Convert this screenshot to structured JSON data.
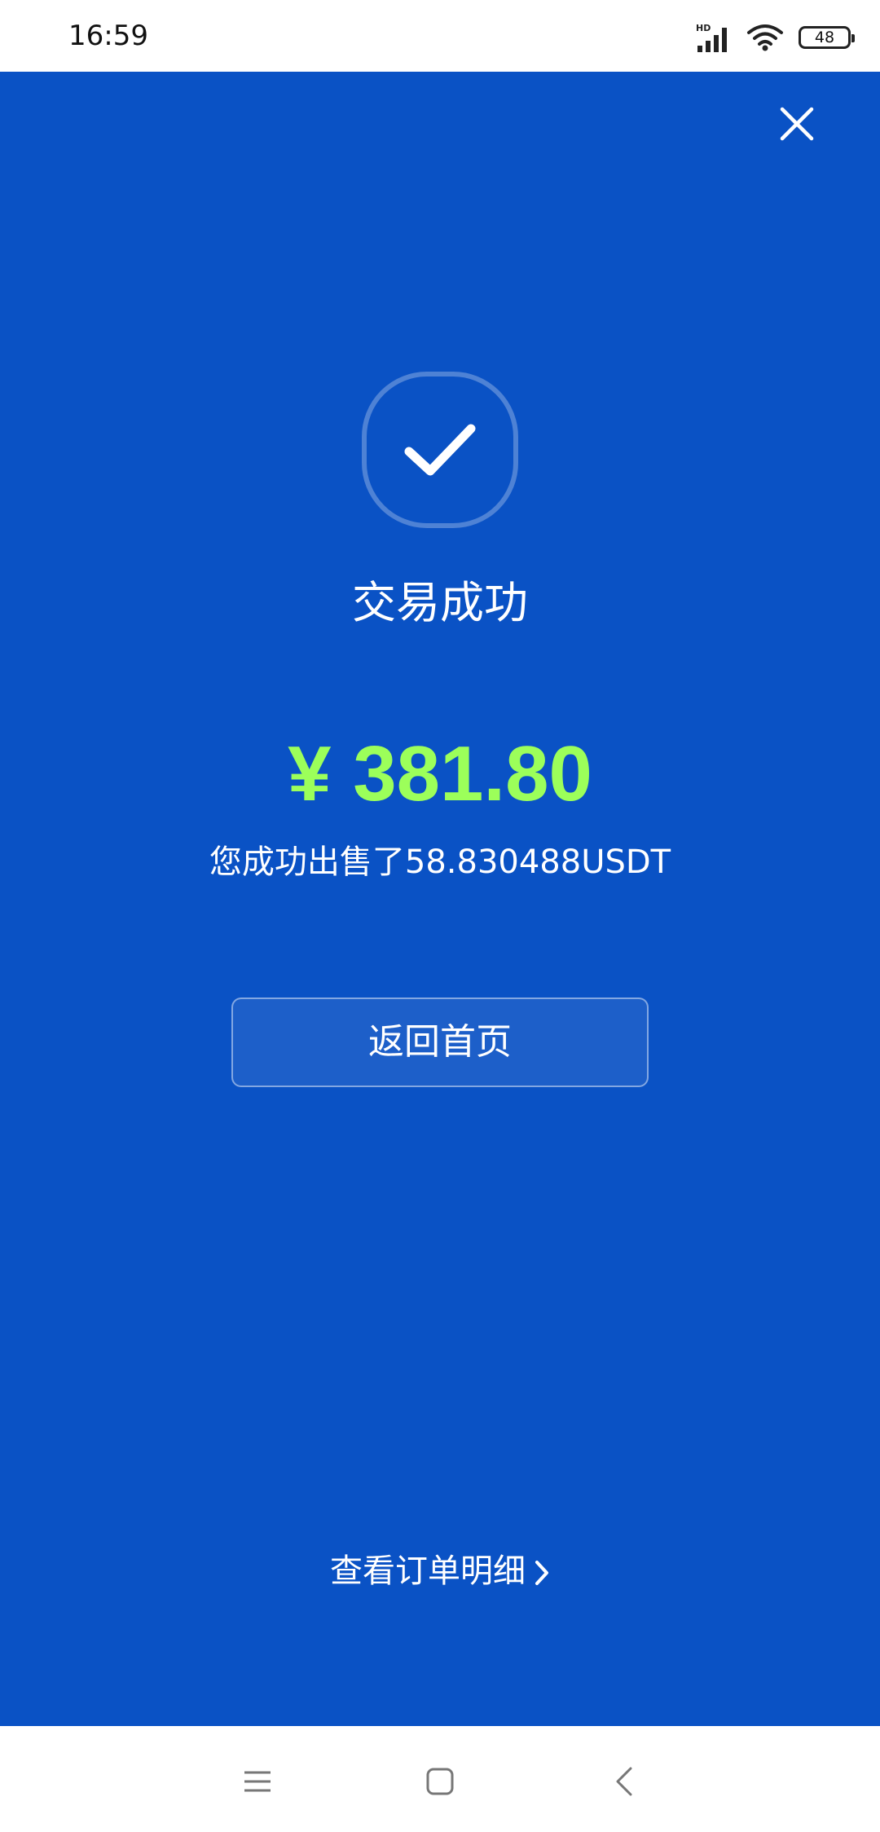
{
  "status_bar": {
    "time": "16:59",
    "network_label": "HD",
    "battery": "48",
    "icons": [
      "signal-icon",
      "wifi-icon",
      "battery-icon"
    ]
  },
  "header": {
    "close_icon": "close-icon"
  },
  "result": {
    "status_icon": "checkmark-icon",
    "title": "交易成功",
    "amount": "¥ 381.80",
    "description": "您成功出售了58.830488USDT"
  },
  "actions": {
    "home_button_label": "返回首页",
    "order_detail_label": "查看订单明细",
    "order_detail_icon": "chevron-right-icon"
  },
  "nav_bar": {
    "icons": [
      "menu-icon",
      "home-icon",
      "back-icon"
    ]
  },
  "colors": {
    "background": "#0a52c5",
    "amount": "#9cff5a",
    "text": "#ffffff"
  }
}
